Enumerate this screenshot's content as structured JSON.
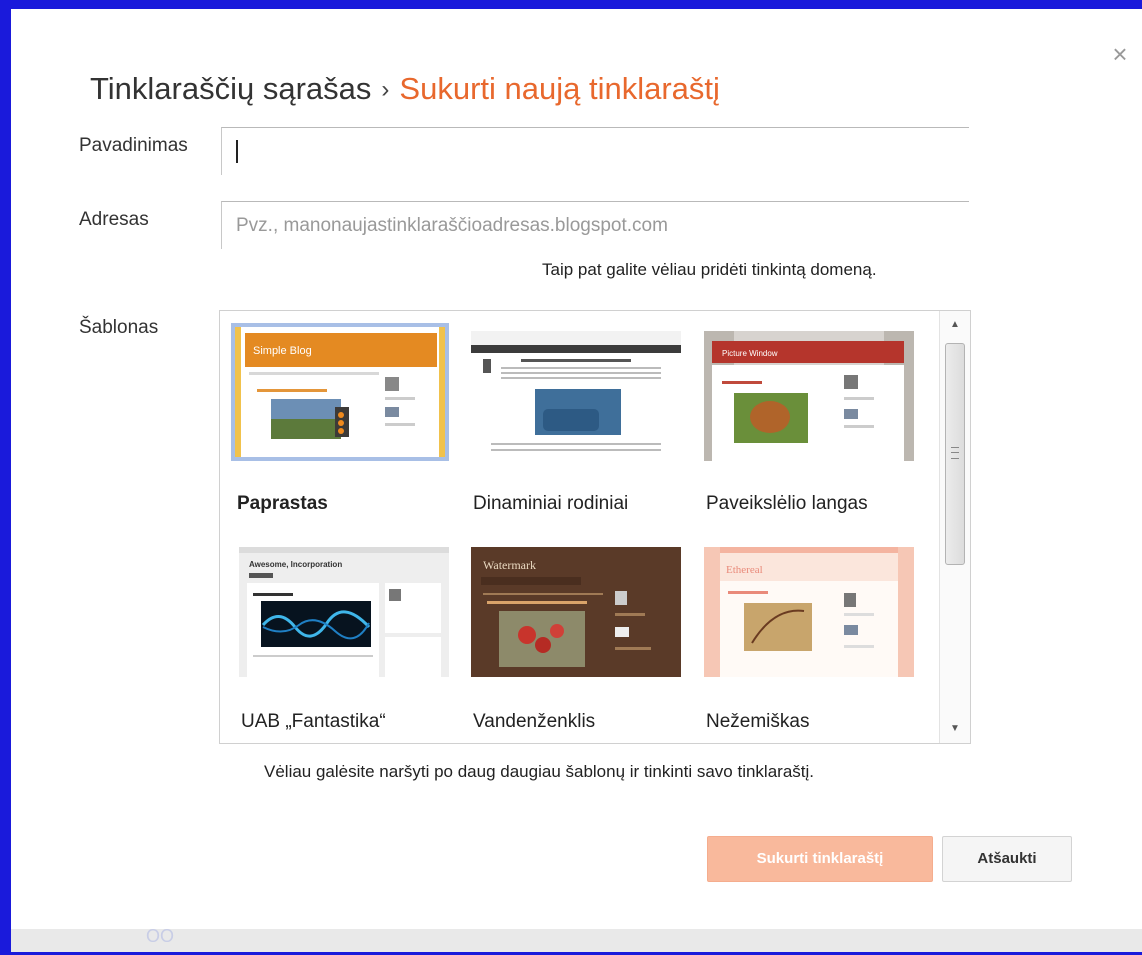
{
  "dialog": {
    "breadcrumb_parent": "Tinklaraščių sąrašas",
    "breadcrumb_separator": "›",
    "breadcrumb_current": "Sukurti naują tinklaraštį",
    "close_icon": "×"
  },
  "form": {
    "name_label": "Pavadinimas",
    "name_value": "",
    "address_label": "Adresas",
    "address_placeholder": "Pvz., manonaujastinklaraščioadresas.blogspot.com",
    "domain_hint": "Taip pat galite vėliau pridėti tinkintą domeną.",
    "template_label": "Šablonas"
  },
  "templates": [
    {
      "name": "Paprastas",
      "selected": true,
      "thumb_title": "Simple Blog"
    },
    {
      "name": "Dinaminiai rodiniai",
      "selected": false,
      "thumb_title": ""
    },
    {
      "name": "Paveikslėlio langas",
      "selected": false,
      "thumb_title": "Picture Window"
    },
    {
      "name": "UAB „Fantastika“",
      "selected": false,
      "thumb_title": "Awesome, Incorporation"
    },
    {
      "name": "Vandenženklis",
      "selected": false,
      "thumb_title": "Watermark"
    },
    {
      "name": "Nežemiškas",
      "selected": false,
      "thumb_title": "Ethereal"
    }
  ],
  "templates_hint": "Vėliau galėsite naršyti po daug daugiau šablonų ir tinkinti savo tinklaraštį.",
  "buttons": {
    "create": "Sukurti tinklaraštį",
    "cancel": "Atšaukti"
  },
  "footer_fragment": "OO",
  "colors": {
    "accent_orange": "#e8682d",
    "primary_button": "#f9b99c",
    "frame_blue": "#1a1adb",
    "selected_outline": "#a8bfe6"
  }
}
